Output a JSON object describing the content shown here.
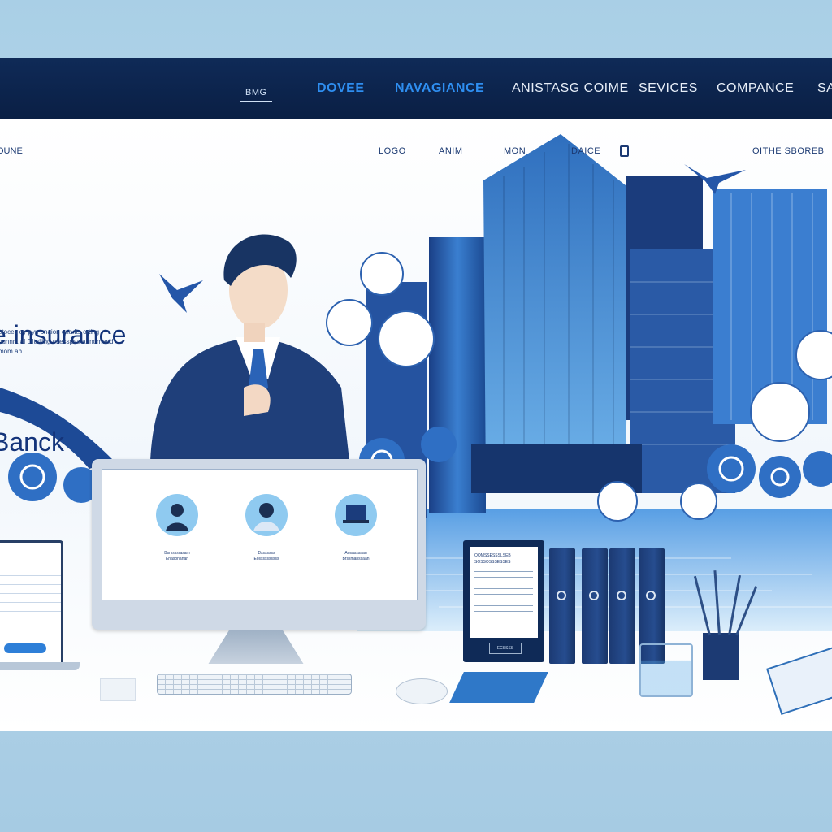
{
  "top_nav": {
    "items": [
      "BMG",
      "DOVEE",
      "NAVAGIANCE",
      "ANISTASG COIME",
      "SEVICES",
      "COMPANCE",
      "SA"
    ]
  },
  "sub_nav": {
    "left": "OUNE",
    "items": [
      "LOGO",
      "ANIM",
      "MON",
      "DAICE"
    ],
    "right": "OITHE SBOREB"
  },
  "hero": {
    "title_line1": "e insurance",
    "title_line2": "Banck",
    "body_line1": "otoces oy pyn onaion ona Its orting",
    "body_line2": "ounnnt aI DItalling osesspea aunornand",
    "body_line3": "mom ab."
  },
  "monitor": {
    "profiles": [
      {
        "icon": "person-icon",
        "label_line1": "Bsmsssrasam",
        "label_line2": "Enasonanan"
      },
      {
        "icon": "user-icon",
        "label_line1": "Dsssssss",
        "label_line2": "Eossssssssss"
      },
      {
        "icon": "laptop-icon",
        "label_line1": "Aosasssaan",
        "label_line2": "Brssmanssaan"
      }
    ]
  },
  "document": {
    "heading1": "OOMSSESSSLSEB",
    "heading2": "SOSSOSSSESSES",
    "button": "ECSSSS"
  },
  "colors": {
    "nav_bg": "#0a1f44",
    "accent": "#2e8ef0",
    "brand_text": "#14347a"
  }
}
